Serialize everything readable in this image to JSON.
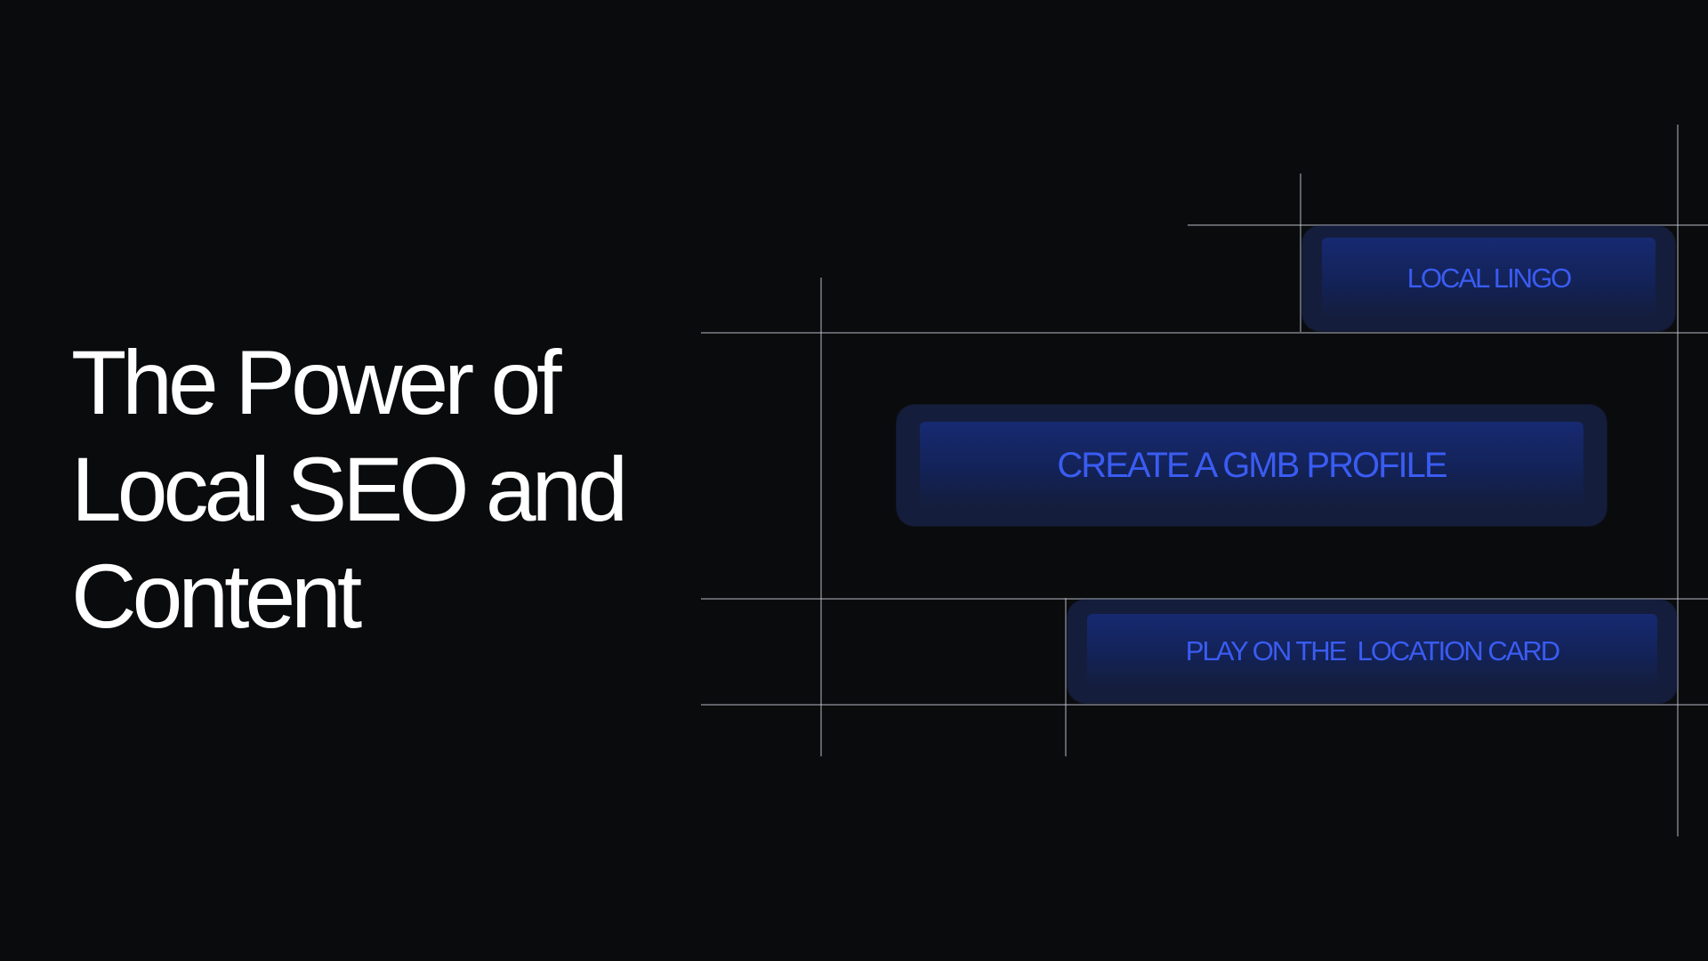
{
  "headline": {
    "lines": [
      "The Power of",
      "Local SEO and",
      "Content"
    ]
  },
  "pills": [
    {
      "label": "LOCAL LINGO"
    },
    {
      "label": "CREATE A GMB PROFILE"
    },
    {
      "label": "PLAY ON THE  LOCATION CARD"
    }
  ],
  "colors": {
    "background": "#0a0b0d",
    "headline_text": "#ffffff",
    "pill_text": "#3a5cf2",
    "pill_fill": "#141d3b",
    "grid_lines": "#c8cdd7"
  }
}
